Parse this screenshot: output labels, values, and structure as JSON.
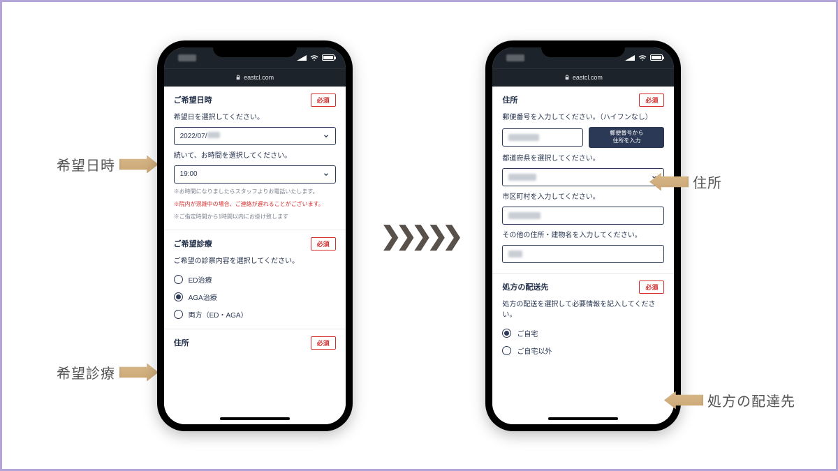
{
  "url": "eastcl.com",
  "badge_required": "必須",
  "screen1": {
    "section_datetime_title": "ご希望日時",
    "date_label": "希望日を選択してください。",
    "date_value_prefix": "2022/07/",
    "time_label": "続いて、お時間を選択してください。",
    "time_value": "19:00",
    "note1": "※お時間になりましたらスタッフよりお電話いたします。",
    "note2_red": "※院内が混雑中の場合、ご連絡が遅れることがございます。",
    "note3": "※ご指定時間から1時間以内にお掛け致します",
    "section_treatment_title": "ご希望診療",
    "treatment_label": "ご希望の診察内容を選択してください。",
    "opt_ed": "ED治療",
    "opt_aga": "AGA治療",
    "opt_both": "両方（ED・AGA）",
    "section_address_title": "住所"
  },
  "screen2": {
    "section_address_title": "住所",
    "zip_label": "郵便番号を入力してください。（ハイフンなし）",
    "zip_button_line1": "郵便番号から",
    "zip_button_line2": "住所を入力",
    "pref_label": "都道府県を選択してください。",
    "city_label": "市区町村を入力してください。",
    "other_label": "その他の住所・建物名を入力してください。",
    "section_delivery_title": "処方の配送先",
    "delivery_label": "処方の配送を選択して必要情報を記入してください。",
    "opt_home": "ご自宅",
    "opt_other": "ご自宅以外"
  },
  "annotations": {
    "datetime": "希望日時",
    "treatment": "希望診療",
    "address": "住所",
    "delivery": "処方の配達先"
  },
  "flow_arrows": "❯❯❯❯❯"
}
